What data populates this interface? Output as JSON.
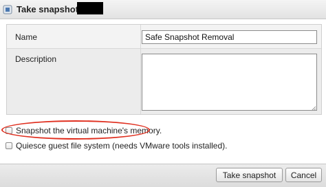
{
  "dialog": {
    "title": "Take snapshot for"
  },
  "form": {
    "name_label": "Name",
    "name_value": "Safe Snapshot Removal",
    "description_label": "Description",
    "description_value": ""
  },
  "options": {
    "memory_label": "Snapshot the virtual machine's memory.",
    "memory_checked": false,
    "quiesce_label": "Quiesce guest file system (needs VMware tools installed).",
    "quiesce_checked": false
  },
  "buttons": {
    "take_snapshot_label": "Take snapshot",
    "cancel_label": "Cancel"
  },
  "colors": {
    "highlight": "#e03020"
  }
}
